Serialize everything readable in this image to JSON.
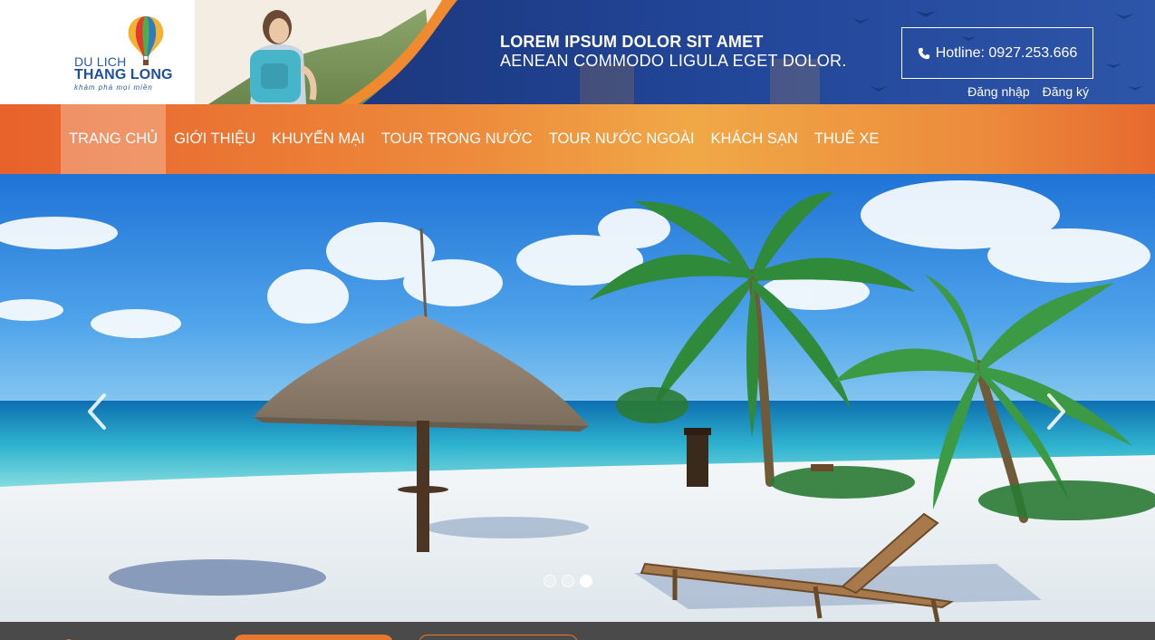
{
  "header": {
    "logo": {
      "line1": "DU LICH",
      "line2": "THANG LONG",
      "line3": "khám phá mọi miền"
    },
    "slogan": {
      "line1": "LOREM IPSUM DOLOR SIT AMET",
      "line2": "AENEAN COMMODO LIGULA EGET DOLOR."
    },
    "hotline": {
      "icon": "phone-icon",
      "label": "Hotline: 0927.253.666"
    },
    "auth": {
      "login": "Đăng nhập",
      "register": "Đăng ký"
    }
  },
  "nav": {
    "items": [
      {
        "label": "TRANG CHỦ",
        "active": true
      },
      {
        "label": "GIỚI THIỆU",
        "active": false
      },
      {
        "label": "KHUYẾN MẠI",
        "active": false
      },
      {
        "label": "TOUR TRONG NƯỚC",
        "active": false
      },
      {
        "label": "TOUR NƯỚC NGOÀI",
        "active": false
      },
      {
        "label": "KHÁCH SẠN",
        "active": false
      },
      {
        "label": "THUÊ XE",
        "active": false
      }
    ]
  },
  "slider": {
    "image": "beach-scene",
    "prev_icon": "chevron-left-icon",
    "next_icon": "chevron-right-icon",
    "slide_count": 3,
    "active_slide": 3
  },
  "colors": {
    "nav_orange": "#ed8a3b",
    "header_blue": "#1f3f8f",
    "logo_blue": "#1f4f9e",
    "strip_gray": "#4a4a4a"
  }
}
